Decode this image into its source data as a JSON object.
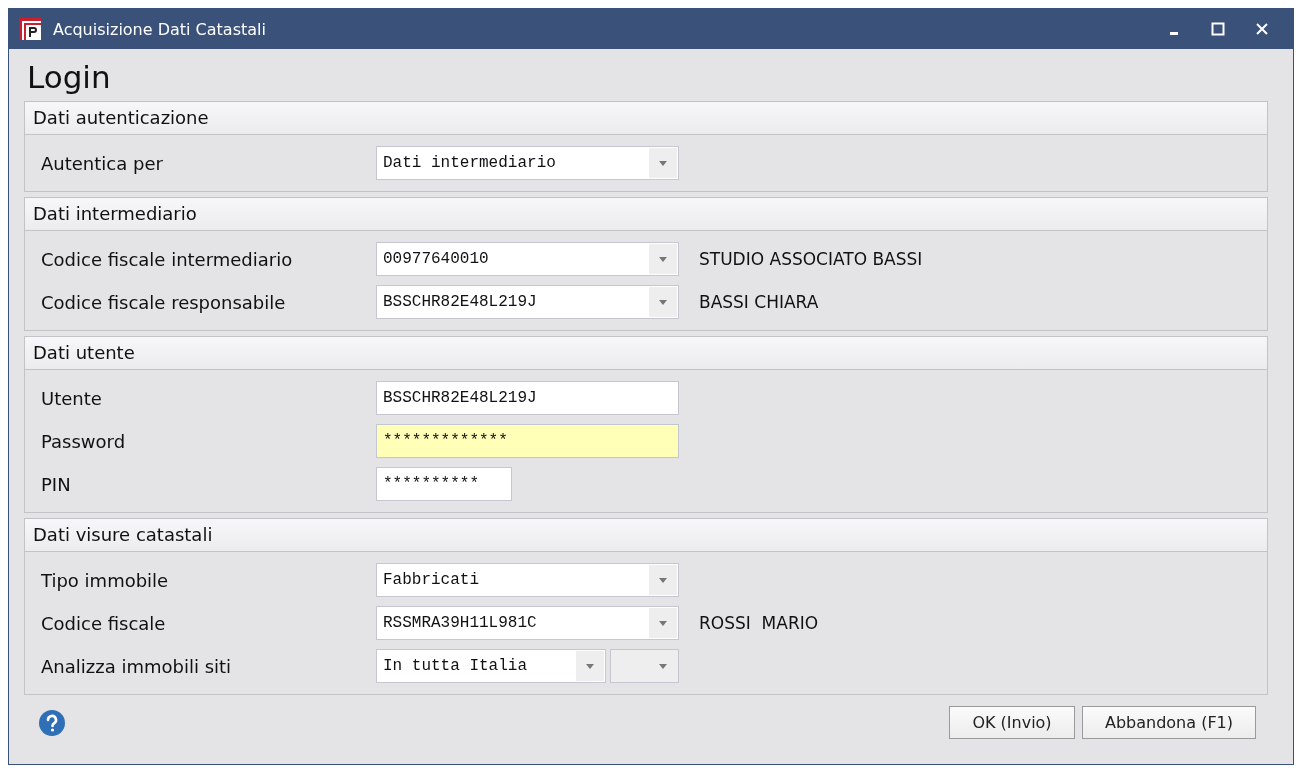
{
  "window": {
    "title": "Acquisizione Dati Catastali"
  },
  "heading": "Login",
  "sections": [
    {
      "title": "Dati autenticazione",
      "rows": [
        {
          "label": "Autentica per",
          "fields": [
            {
              "kind": "combo",
              "value": "Dati intermediario",
              "highlighted": false
            }
          ]
        }
      ]
    },
    {
      "title": "Dati intermediario",
      "rows": [
        {
          "label": "Codice fiscale intermediario",
          "fields": [
            {
              "kind": "combo",
              "value": "00977640010",
              "highlighted": false
            }
          ],
          "note": "STUDIO ASSOCIATO BASSI"
        },
        {
          "label": "Codice fiscale responsabile",
          "fields": [
            {
              "kind": "combo",
              "value": "BSSCHR82E48L219J",
              "highlighted": false
            }
          ],
          "note": "BASSI CHIARA"
        }
      ]
    },
    {
      "title": "Dati utente",
      "rows": [
        {
          "label": "Utente",
          "fields": [
            {
              "kind": "text",
              "value": "BSSCHR82E48L219J",
              "highlighted": false
            }
          ]
        },
        {
          "label": "Password",
          "fields": [
            {
              "kind": "text",
              "value": "*************",
              "highlighted": true
            }
          ]
        },
        {
          "label": "PIN",
          "fields": [
            {
              "kind": "short-text",
              "value": "**********",
              "highlighted": false
            }
          ]
        }
      ]
    },
    {
      "title": "Dati visure catastali",
      "rows": [
        {
          "label": "Tipo immobile",
          "fields": [
            {
              "kind": "combo",
              "value": "Fabbricati",
              "highlighted": false
            }
          ]
        },
        {
          "label": "Codice fiscale",
          "fields": [
            {
              "kind": "combo",
              "value": "RSSMRA39H11L981C",
              "highlighted": false
            }
          ],
          "note": "ROSSI  MARIO"
        },
        {
          "label": "Analizza immobili siti",
          "fields": [
            {
              "kind": "split-combo",
              "value": "In tutta Italia",
              "highlighted": false
            },
            {
              "kind": "empty-combo",
              "highlighted": false
            }
          ]
        }
      ]
    }
  ],
  "buttons": [
    "OK (Invio)",
    "Abbandona (F1)"
  ]
}
